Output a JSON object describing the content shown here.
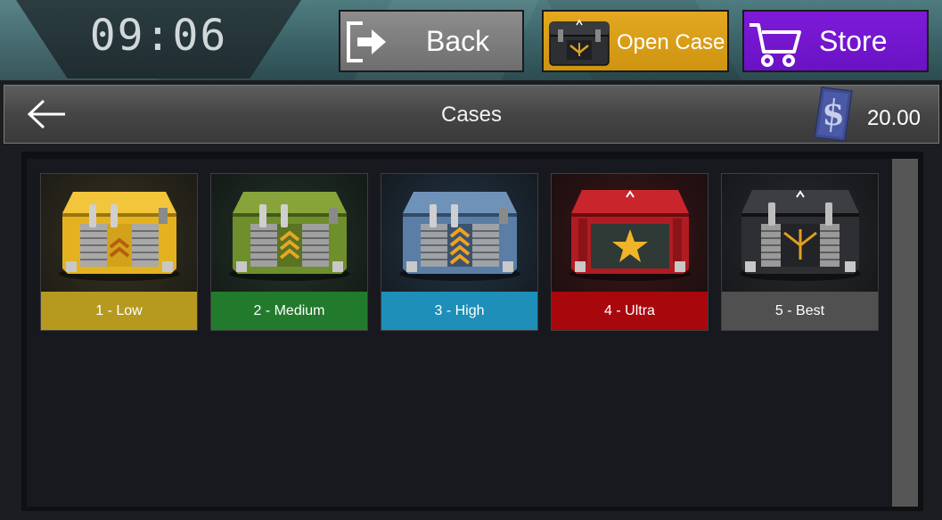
{
  "clock": "09:06",
  "top_buttons": {
    "back": "Back",
    "open_case": "Open Case",
    "store": "Store"
  },
  "header": {
    "title": "Cases",
    "balance": "20.00"
  },
  "cases": [
    {
      "label": "1 - Low",
      "color": "#b59a1f"
    },
    {
      "label": "2 - Medium",
      "color": "#227a2c"
    },
    {
      "label": "3 - High",
      "color": "#1d8fb9"
    },
    {
      "label": "4 - Ultra",
      "color": "#a8080c"
    },
    {
      "label": "5 - Best",
      "color": "#505050"
    }
  ],
  "colors": {
    "back_button": "#7d7d7d",
    "open_case_button": "#d99c16",
    "store_button": "#7417cf",
    "topbar": "#3a6266"
  },
  "icons": {
    "back_button": "exit-icon",
    "open_case_button": "case-icon",
    "store_button": "cart-icon",
    "header_back": "arrow-left-icon",
    "balance": "coin-icon"
  }
}
